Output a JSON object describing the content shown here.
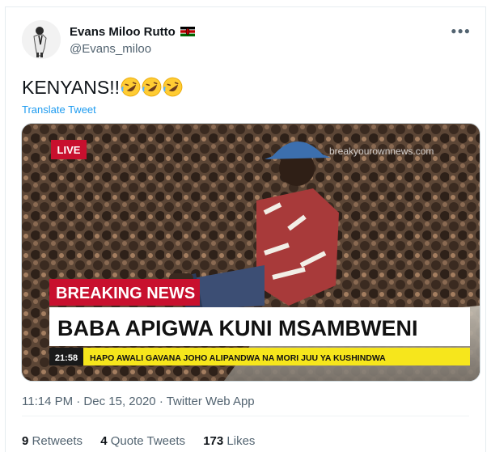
{
  "tweet": {
    "author_name": "Evans Miloo Rutto",
    "author_handle": "@Evans_miloo",
    "flag_icon": "kenya-flag-icon",
    "more_icon": "more-options-icon",
    "text": "KENYANS!!",
    "emojis": [
      "rolling-on-floor-laughing-emoji",
      "rolling-on-floor-laughing-emoji",
      "rolling-on-floor-laughing-emoji"
    ],
    "translate_label": "Translate Tweet",
    "timestamp": "11:14 PM · Dec 15, 2020 · Twitter Web App",
    "link_color": "#1d9bf0"
  },
  "media": {
    "live_label": "LIVE",
    "watermark": "breakyourownnews.com",
    "breaking_label": "BREAKING NEWS",
    "headline": "BABA APIGWA KUNI MSAMBWENI",
    "clock": "21:58",
    "ticker": "HAPO AWALI GAVANA JOHO ALIPANDWA NA MORI JUU YA KUSHINDWA",
    "colors": {
      "red": "#c8102e",
      "ticker_yellow": "#f6e61c",
      "clock_bg": "#1a1a1a"
    }
  },
  "stats": {
    "retweets_count": "9",
    "retweets_label": "Retweets",
    "quotes_count": "4",
    "quotes_label": "Quote Tweets",
    "likes_count": "173",
    "likes_label": "Likes"
  }
}
